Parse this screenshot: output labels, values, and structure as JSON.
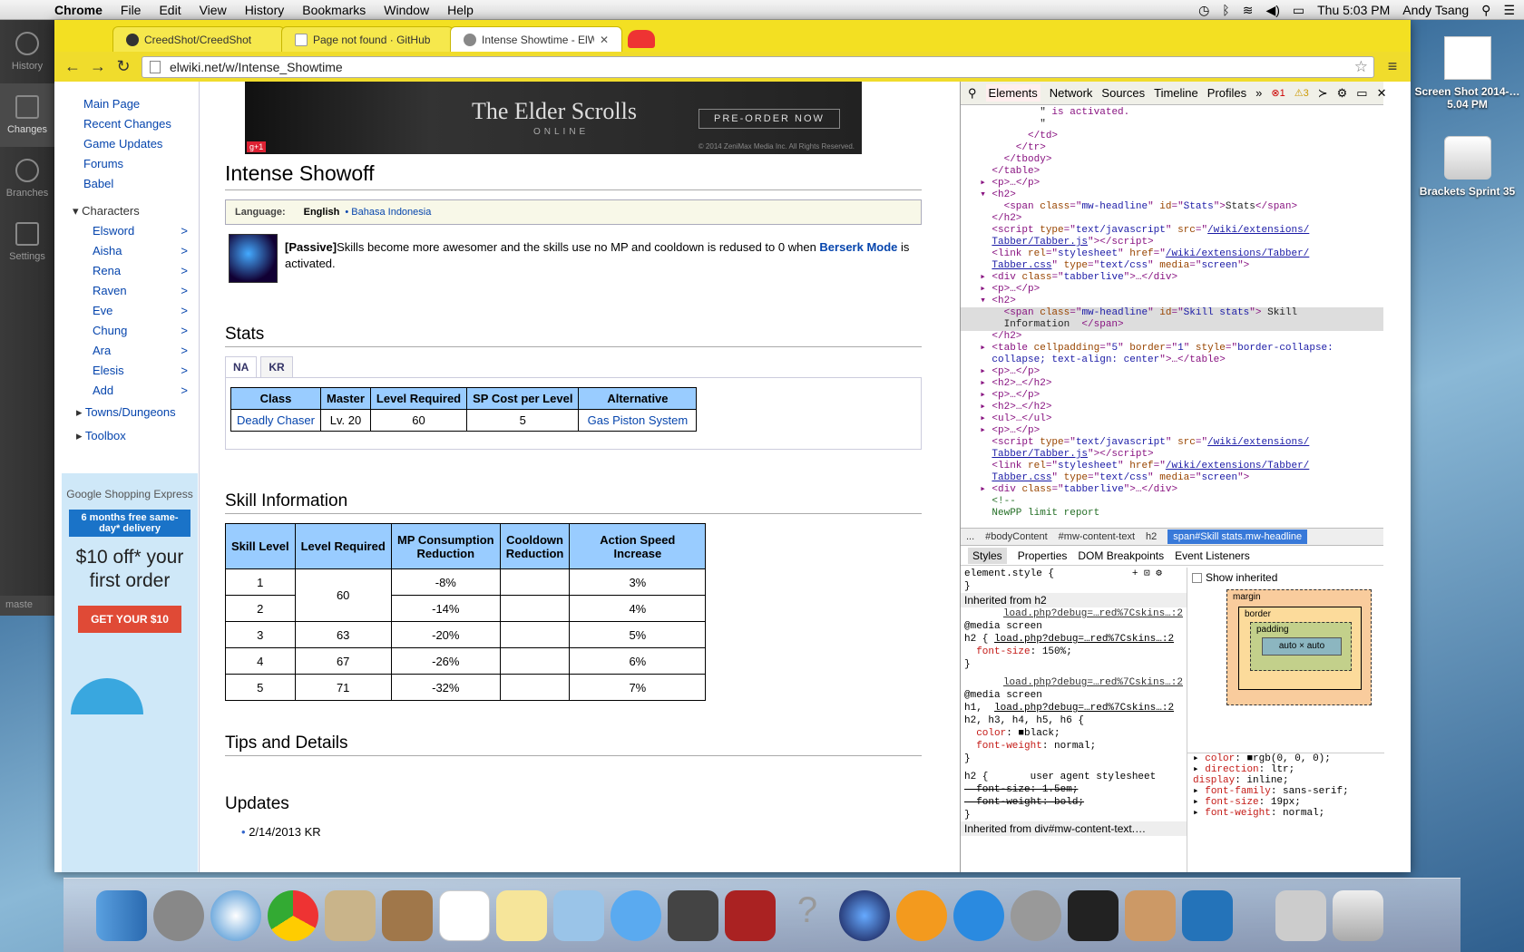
{
  "menubar": {
    "app": "Chrome",
    "items": [
      "File",
      "Edit",
      "View",
      "History",
      "Bookmarks",
      "Window",
      "Help"
    ],
    "clock": "Thu 5:03 PM",
    "user": "Andy Tsang"
  },
  "leftbar": {
    "items": [
      "History",
      "Changes",
      "Branches",
      "Settings"
    ],
    "branch": "maste"
  },
  "tabs": [
    {
      "label": "CreedShot/CreedShot"
    },
    {
      "label": "Page not found · GitHub"
    },
    {
      "label": "Intense Showtime - ElWiki"
    }
  ],
  "url": "elwiki.net/w/Intense_Showtime",
  "sidebar": {
    "links": [
      "Main Page",
      "Recent Changes",
      "Game Updates",
      "Forums",
      "Babel"
    ],
    "characters_label": "Characters",
    "characters": [
      "Elsword",
      "Aisha",
      "Rena",
      "Raven",
      "Eve",
      "Chung",
      "Ara",
      "Elesis",
      "Add"
    ],
    "collapsed": [
      "Towns/Dungeons",
      "Toolbox"
    ]
  },
  "ad_side": {
    "brand": "Google Shopping Express",
    "band": "6 months free same-day* delivery",
    "offer": "$10 off* your first order",
    "cta": "GET YOUR $10"
  },
  "banner": {
    "title": "The Elder Scrolls",
    "subtitle": "ONLINE",
    "cta": "PRE-ORDER NOW",
    "gplus": "g+1",
    "copyright": "© 2014 ZeniMax Media Inc. All Rights Reserved."
  },
  "page": {
    "title": "Intense Showoff",
    "language_label": "Language:",
    "lang_current": "English",
    "lang_other": "Bahasa Indonesia",
    "skill_tag": "[Passive]",
    "skill_text": "Skills become more awesomer and the skills use no MP and cooldown is redused to 0 when ",
    "skill_link": "Berserk Mode",
    "skill_tail": " is activated.",
    "stats_heading": "Stats",
    "region_tabs": [
      "NA",
      "KR"
    ],
    "stats_headers": [
      "Class",
      "Master",
      "Level Required",
      "SP Cost per Level",
      "Alternative"
    ],
    "stats_row": [
      "Deadly Chaser",
      "Lv. 20",
      "60",
      "5",
      "Gas Piston System"
    ],
    "skillinfo_heading": "Skill Information",
    "skill_headers": [
      "Skill Level",
      "Level Required",
      "MP Consumption Reduction",
      "Cooldown Reduction",
      "Action Speed Increase"
    ],
    "skill_rows": [
      [
        "1",
        "60",
        "-8%",
        "3%"
      ],
      [
        "2",
        "",
        "-14%",
        "4%"
      ],
      [
        "3",
        "63",
        "-20%",
        "5%"
      ],
      [
        "4",
        "67",
        "-26%",
        "6%"
      ],
      [
        "5",
        "71",
        "-32%",
        "7%"
      ]
    ],
    "tips_heading": "Tips and Details",
    "updates_heading": "Updates",
    "update_item": "2/14/2013 KR"
  },
  "devtools": {
    "tabs": [
      "Elements",
      "Network",
      "Sources",
      "Timeline",
      "Profiles"
    ],
    "errors": "1",
    "warnings": "3",
    "crumbs": [
      "...",
      "#bodyContent",
      "#mw-content-text",
      "h2",
      "span#Skill stats.mw-headline"
    ],
    "style_tabs": [
      "Styles",
      "Properties",
      "DOM Breakpoints",
      "Event Listeners"
    ],
    "show_inherited": "Show inherited",
    "inherited_h2": "Inherited from h2",
    "inherited_div": "Inherited from div#mw-content-text.…",
    "box": {
      "margin": "margin",
      "border": "border",
      "padding": "padding",
      "content": "auto × auto",
      "dash": "-"
    }
  },
  "desktop": [
    {
      "label": "Screen Shot 2014-…5.04 PM"
    },
    {
      "label": "Brackets Sprint 35"
    }
  ]
}
